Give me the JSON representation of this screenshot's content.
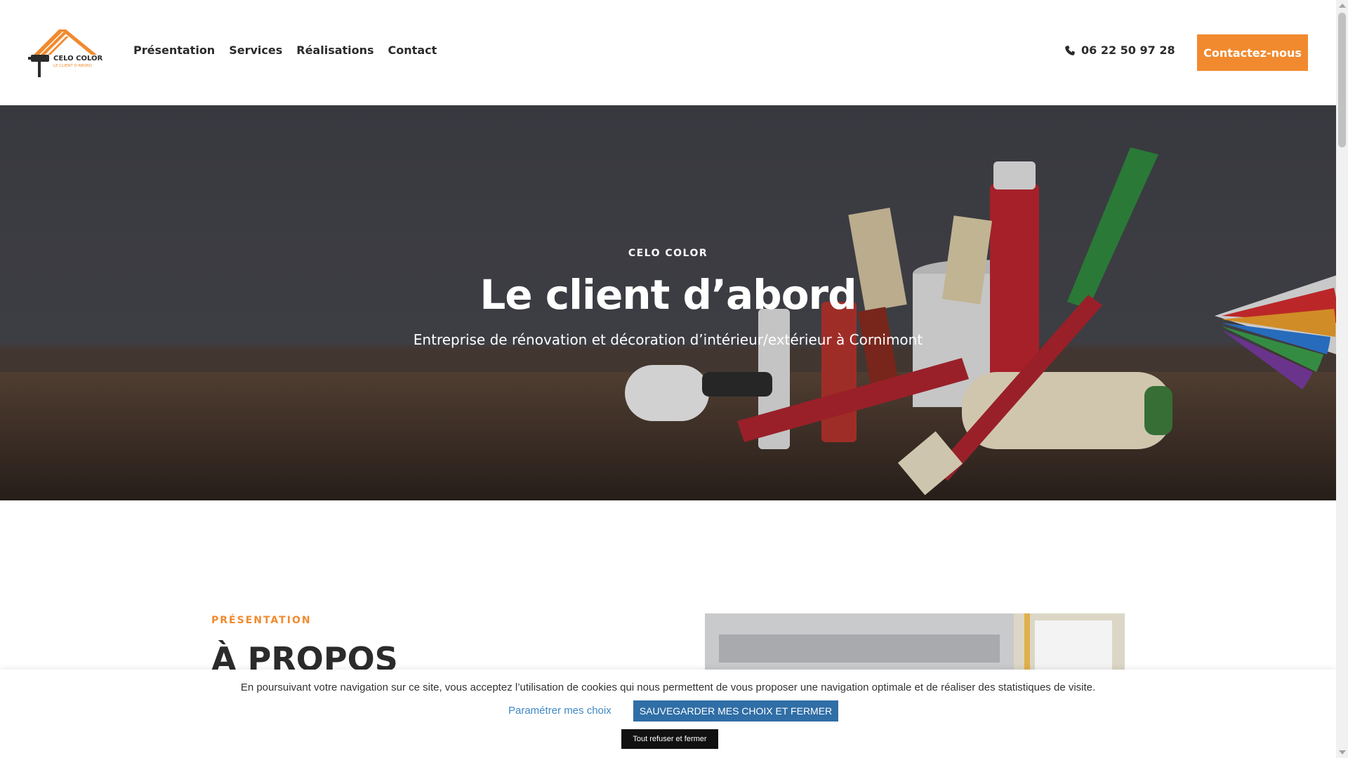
{
  "header": {
    "logo": {
      "name": "CELO COLOR",
      "tagline": "LE CLIENT D'ABORD"
    },
    "nav": [
      {
        "label": "Présentation"
      },
      {
        "label": "Services"
      },
      {
        "label": "Réalisations"
      },
      {
        "label": "Contact"
      }
    ],
    "phone": "06 22 50 97 28",
    "cta_label": "Contactez-nous"
  },
  "hero": {
    "eyebrow": "CELO COLOR",
    "title": "Le client d’abord",
    "subtitle": "Entreprise de rénovation et décoration d’intérieur/extérieur à Cornimont"
  },
  "presentation": {
    "eyebrow": "PRÉSENTATION",
    "title": "À PROPOS"
  },
  "cookie_banner": {
    "text": "En poursuivant votre navigation sur ce site, vous acceptez l’utilisation de cookies qui nous permettent de vous proposer une navigation optimale et de réaliser des statistiques de visite.",
    "settings_link": "Paramétrer mes choix",
    "save_button": "SAUVEGARDER MES CHOIX ET FERMER",
    "refuse_button": "Tout refuser et fermer"
  },
  "colors": {
    "accent": "#f18a2e",
    "cookie_button": "#2f6ea6",
    "link": "#3f88c5",
    "text_dark": "#2b2b2b"
  },
  "icons": {
    "phone": "phone-icon",
    "logo": "paint-roller-roof-logo"
  }
}
